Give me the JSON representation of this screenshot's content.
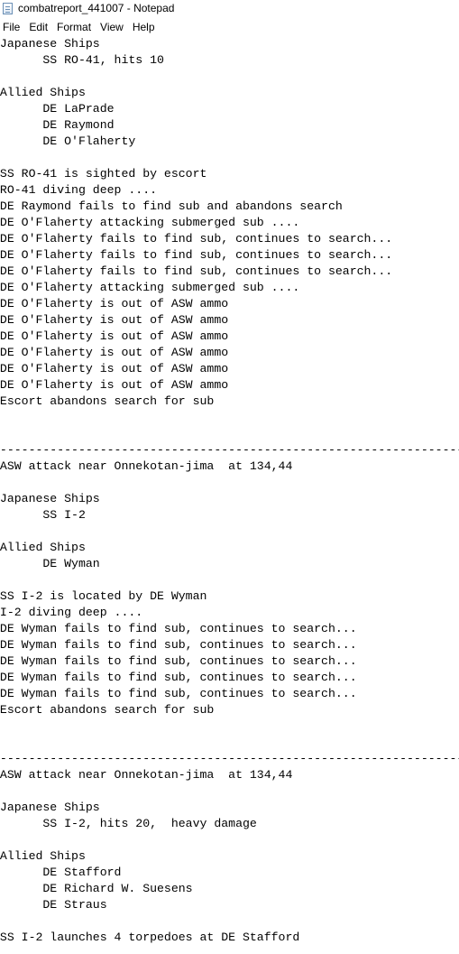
{
  "window": {
    "title": "combatreport_441007 - Notepad"
  },
  "menu": [
    "File",
    "Edit",
    "Format",
    "View",
    "Help"
  ],
  "document": {
    "lines": [
      " Japanese Ships",
      "       SS RO-41, hits 10",
      "",
      " Allied Ships",
      "       DE LaPrade",
      "       DE Raymond",
      "       DE O'Flaherty",
      "",
      " SS RO-41 is sighted by escort",
      " RO-41 diving deep ....",
      " DE Raymond fails to find sub and abandons search",
      " DE O'Flaherty attacking submerged sub ....",
      " DE O'Flaherty fails to find sub, continues to search...",
      " DE O'Flaherty fails to find sub, continues to search...",
      " DE O'Flaherty fails to find sub, continues to search...",
      " DE O'Flaherty attacking submerged sub ....",
      " DE O'Flaherty is out of ASW ammo",
      " DE O'Flaherty is out of ASW ammo",
      " DE O'Flaherty is out of ASW ammo",
      " DE O'Flaherty is out of ASW ammo",
      " DE O'Flaherty is out of ASW ammo",
      " DE O'Flaherty is out of ASW ammo",
      " Escort abandons search for sub",
      "",
      "",
      "---------------------------------------------------------------------",
      " ASW attack near Onnekotan-jima  at 134,44",
      "",
      " Japanese Ships",
      "       SS I-2",
      "",
      " Allied Ships",
      "       DE Wyman",
      "",
      " SS I-2 is located by DE Wyman",
      " I-2 diving deep ....",
      " DE Wyman fails to find sub, continues to search...",
      " DE Wyman fails to find sub, continues to search...",
      " DE Wyman fails to find sub, continues to search...",
      " DE Wyman fails to find sub, continues to search...",
      " DE Wyman fails to find sub, continues to search...",
      " Escort abandons search for sub",
      "",
      "",
      "---------------------------------------------------------------------",
      " ASW attack near Onnekotan-jima  at 134,44",
      "",
      " Japanese Ships",
      "       SS I-2, hits 20,  heavy damage",
      "",
      " Allied Ships",
      "       DE Stafford",
      "       DE Richard W. Suesens",
      "       DE Straus",
      "",
      " SS I-2 launches 4 torpedoes at DE Stafford"
    ]
  }
}
